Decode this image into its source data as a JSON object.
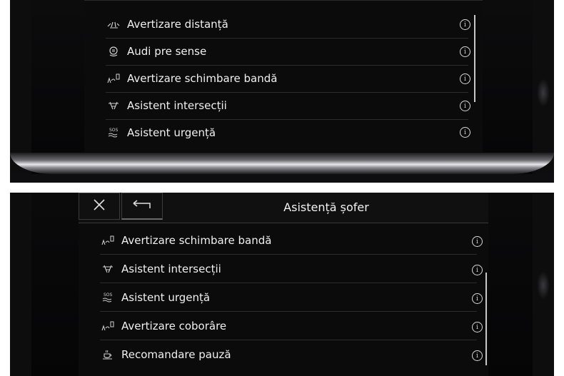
{
  "top_screen": {
    "items": [
      {
        "icon": "distance-warning-icon",
        "label": "Avertizare distanță",
        "info": "i"
      },
      {
        "icon": "pre-sense-icon",
        "label": "Audi pre sense",
        "info": "i"
      },
      {
        "icon": "lane-change-icon",
        "label": "Avertizare schimbare bandă",
        "info": "i"
      },
      {
        "icon": "intersection-icon",
        "label": "Asistent intersecții",
        "info": "i"
      },
      {
        "icon": "emergency-sos-icon",
        "label": "Asistent urgență",
        "info": "i"
      }
    ]
  },
  "bottom_screen": {
    "title": "Asistență șofer",
    "items": [
      {
        "icon": "lane-change-icon",
        "label": "Avertizare schimbare bandă",
        "info": "i"
      },
      {
        "icon": "intersection-icon",
        "label": "Asistent intersecții",
        "info": "i"
      },
      {
        "icon": "emergency-sos-icon",
        "label": "Asistent urgență",
        "info": "i"
      },
      {
        "icon": "exit-warning-icon",
        "label": "Avertizare coborâre",
        "info": "i"
      },
      {
        "icon": "coffee-cup-icon",
        "label": "Recomandare pauză",
        "info": "i"
      }
    ]
  }
}
